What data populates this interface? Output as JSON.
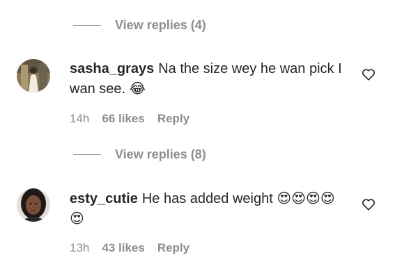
{
  "thread": [
    {
      "view_replies": "View replies (4)"
    },
    {
      "username": "sasha_grays",
      "text": "Na the size wey he wan pick I wan see.",
      "emoji": "😂",
      "time": "14h",
      "likes": "66 likes",
      "reply": "Reply"
    },
    {
      "view_replies": "View replies (8)"
    },
    {
      "username": "esty_cutie",
      "text": "He has added weight",
      "emoji": "😍😍😍😍😍",
      "time": "13h",
      "likes": "43 likes",
      "reply": "Reply"
    }
  ]
}
